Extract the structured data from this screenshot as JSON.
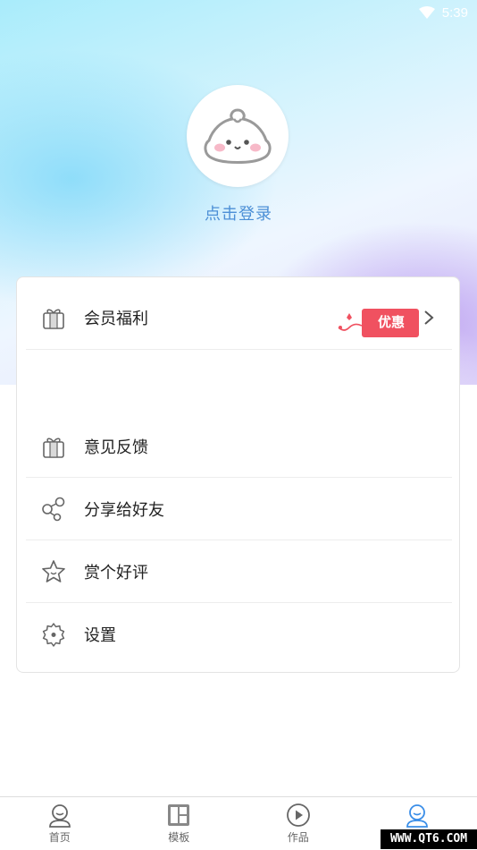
{
  "status_bar": {
    "time": "5:39"
  },
  "profile": {
    "login_text": "点击登录"
  },
  "menu": {
    "member": {
      "label": "会员福利",
      "badge": "优惠"
    },
    "items": [
      {
        "label": "意见反馈",
        "icon": "gift-icon"
      },
      {
        "label": "分享给好友",
        "icon": "share-icon"
      },
      {
        "label": "赏个好评",
        "icon": "star-icon"
      },
      {
        "label": "设置",
        "icon": "gear-icon"
      }
    ]
  },
  "tabbar": {
    "tabs": [
      {
        "label": "首页",
        "icon": "home-user-icon"
      },
      {
        "label": "模板",
        "icon": "template-icon"
      },
      {
        "label": "作品",
        "icon": "play-icon"
      },
      {
        "label": "",
        "icon": "profile-icon",
        "active": true
      }
    ]
  },
  "watermark": "WWW.QT6.COM",
  "colors": {
    "accent": "#3a8ee8",
    "badge": "#f05160",
    "login_text": "#4c8fd6"
  }
}
